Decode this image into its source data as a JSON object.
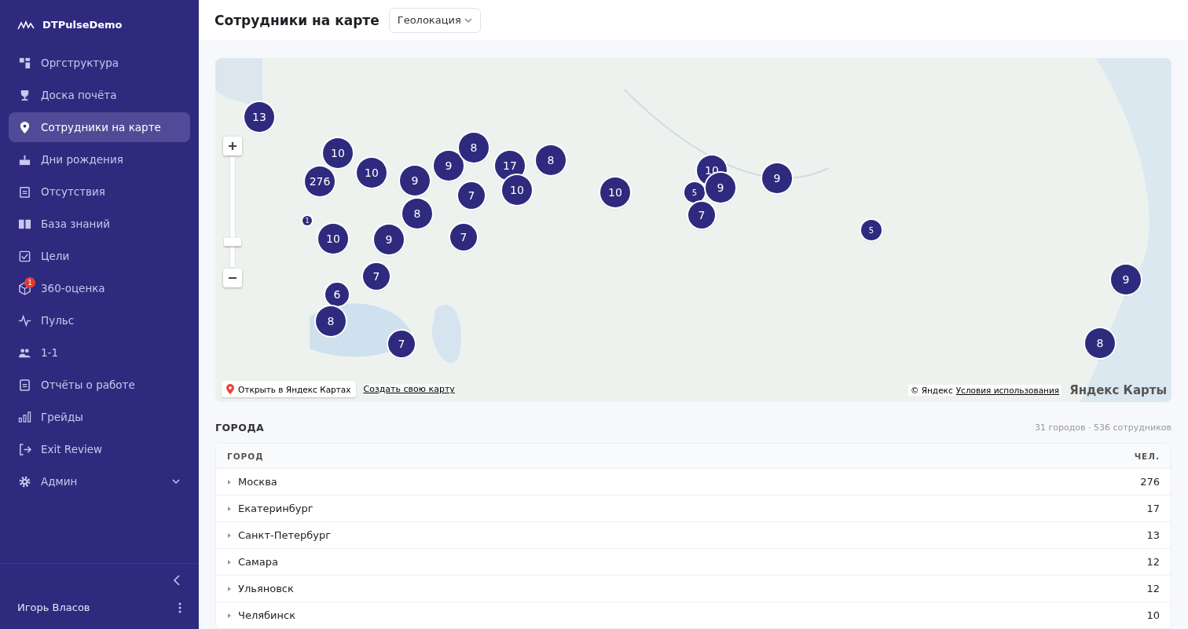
{
  "sidebar": {
    "brand": "DTPulseDemo",
    "items": [
      {
        "label": "Оргструктура",
        "selected": false
      },
      {
        "label": "Доска почёта",
        "selected": false
      },
      {
        "label": "Сотрудники на карте",
        "selected": true
      },
      {
        "label": "Дни рождения",
        "selected": false
      },
      {
        "label": "Отсутствия",
        "selected": false
      },
      {
        "label": "База знаний",
        "selected": false
      },
      {
        "label": "Цели",
        "selected": false
      },
      {
        "label": "360-оценка",
        "selected": false,
        "badge": "1"
      },
      {
        "label": "Пульс",
        "selected": false
      },
      {
        "label": "1-1",
        "selected": false
      },
      {
        "label": "Отчёты о работе",
        "selected": false
      },
      {
        "label": "Грейды",
        "selected": false
      },
      {
        "label": "Exit Review",
        "selected": false
      },
      {
        "label": "Админ",
        "selected": false,
        "expanded": false
      }
    ],
    "user": "Игорь Власов"
  },
  "header": {
    "title": "Сотрудники на карте",
    "dropdown": "Геолокация"
  },
  "map": {
    "zoom": {
      "level": 0.23
    },
    "clusters": [
      "13",
      "10",
      "276",
      "10",
      "9",
      "8",
      "9",
      "8",
      "7",
      "17",
      "10",
      "8",
      "10",
      "10",
      "5",
      "9",
      "7",
      "9",
      "5",
      "9",
      "8",
      "1",
      "10",
      "9",
      "7",
      "7",
      "6",
      "8",
      "7"
    ],
    "open_link": "Открыть в Яндекс Картах",
    "create_link": "Создать свою карту",
    "copyright": "© Яндекс",
    "terms": "Условия использования",
    "logo": "Яндекс Карты"
  },
  "cities": {
    "title": "ГОРОДА",
    "summary": "31 городов · 536 сотрудников",
    "columns": [
      "ГОРОД",
      "ЧЕЛ."
    ],
    "rows": [
      {
        "city": "Москва",
        "count": "276",
        "expanded": false
      },
      {
        "city": "Екатеринбург",
        "count": "17",
        "expanded": false
      },
      {
        "city": "Санкт-Петербург",
        "count": "13",
        "expanded": false
      },
      {
        "city": "Самара",
        "count": "12",
        "expanded": false
      },
      {
        "city": "Ульяновск",
        "count": "12",
        "expanded": false
      },
      {
        "city": "Челябинск",
        "count": "10",
        "expanded": false
      }
    ]
  }
}
